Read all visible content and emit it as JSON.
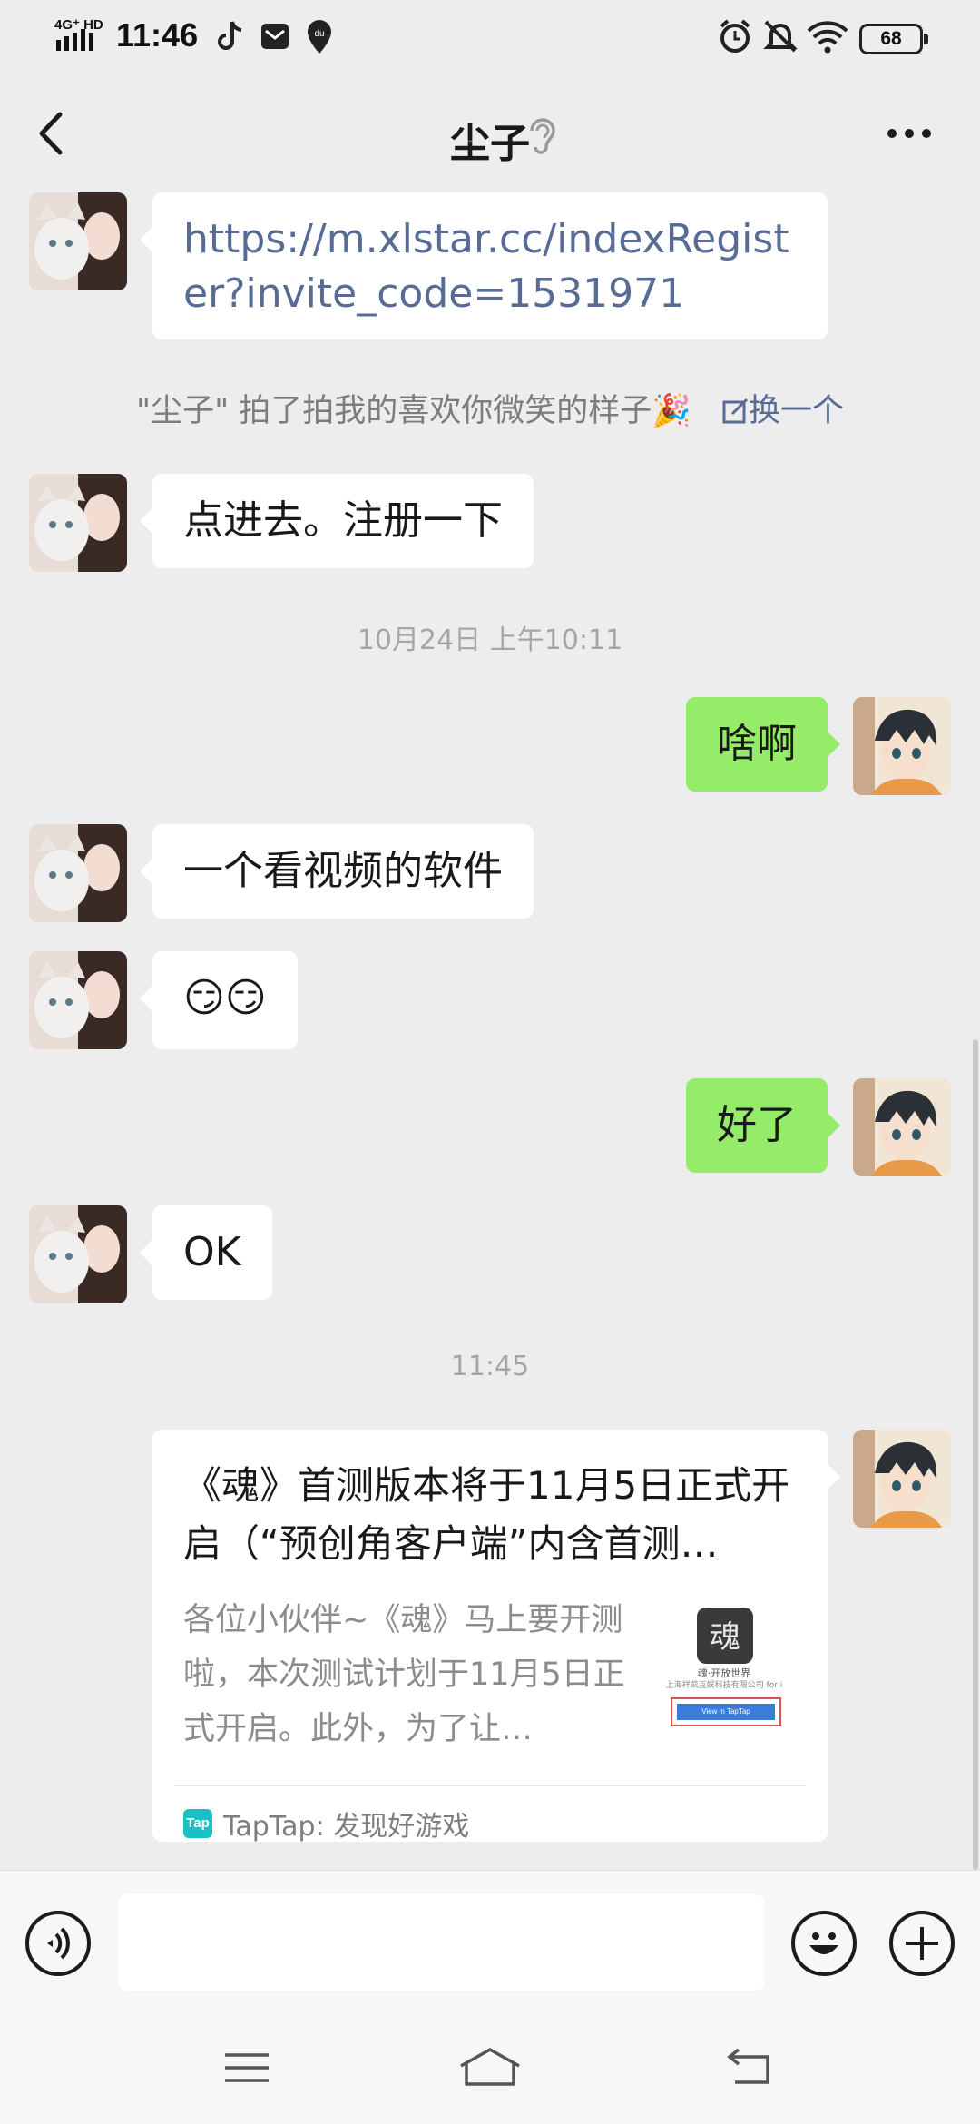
{
  "status_bar": {
    "network": "4G⁺ HD",
    "time": "11:46",
    "battery": "68",
    "icons": [
      "tiktok-icon",
      "mail-icon",
      "location-icon",
      "alarm-icon",
      "mute-icon",
      "wifi-icon",
      "battery-icon"
    ]
  },
  "header": {
    "title": "尘子",
    "back_icon": "back-icon",
    "ear_icon": "ear-icon",
    "more_icon": "more-icon"
  },
  "messages": {
    "m1_link": "https://m.xlstar.cc/indexRegister?invite_code=1531971",
    "pat": {
      "text": "\"尘子\" 拍了拍我的喜欢你微笑的样子🎉",
      "change": "换一个"
    },
    "m2": "点进去。注册一下",
    "ts1": "10月24日 上午10:11",
    "m3": "啥啊",
    "m4": "一个看视频的软件",
    "m5": "😏😏",
    "m6": "好了",
    "m7": "OK",
    "ts2": "11:45"
  },
  "card": {
    "title": "《魂》首测版本将于11月5日正式开启（“预创角客户端”内含首测…",
    "desc": "各位小伙伴~《魂》马上要开测啦，本次测试计划于11月5日正式开启。此外，为了让…",
    "thumb_line1": "魂·开放世界",
    "thumb_line2": "上海祥凯互娱科技有限公司 for i",
    "thumb_btn": "View in TapTap",
    "source": "TapTap: 发现好游戏",
    "source_logo": "Tap"
  },
  "input": {
    "value": "",
    "voice_icon": "voice-icon",
    "emoji_icon": "emoji-icon",
    "plus_icon": "plus-icon"
  },
  "colors": {
    "background": "#ededed",
    "bubble_out": "#95ec69",
    "bubble_in": "#ffffff",
    "link": "#576b95"
  }
}
